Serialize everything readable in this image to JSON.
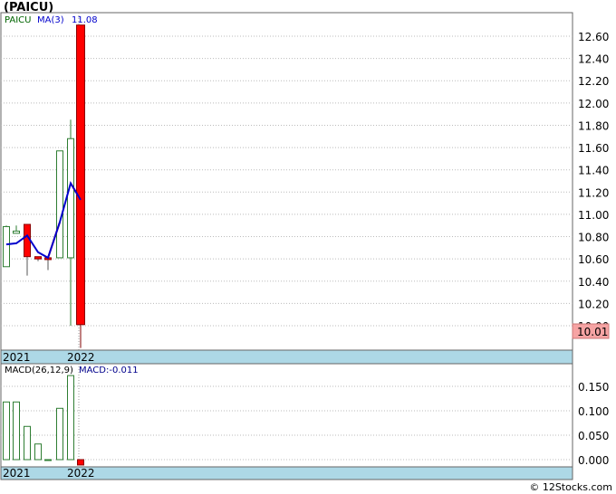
{
  "chart_data": [
    {
      "type": "candlestick",
      "title": "(PAICU)",
      "legend": {
        "symbol": "PAICU",
        "ma_label": "MA(3)",
        "last_value": "11.08"
      },
      "ylim": [
        10.0,
        12.75
      ],
      "yticks": [
        "12.60",
        "12.40",
        "12.20",
        "12.00",
        "11.80",
        "11.60",
        "11.40",
        "11.20",
        "11.00",
        "10.80",
        "10.60",
        "10.40",
        "10.20",
        "10.00"
      ],
      "x_labels": [
        "2021",
        "2022"
      ],
      "last_price_label": "10.01",
      "candles": [
        {
          "open": 10.53,
          "high": 10.9,
          "low": 10.53,
          "close": 10.89,
          "color": "green"
        },
        {
          "open": 10.83,
          "high": 10.9,
          "low": 10.83,
          "close": 10.85,
          "color": "green"
        },
        {
          "open": 10.91,
          "high": 10.91,
          "low": 10.45,
          "close": 10.62,
          "color": "red"
        },
        {
          "open": 10.62,
          "high": 10.62,
          "low": 10.58,
          "close": 10.6,
          "color": "red"
        },
        {
          "open": 10.61,
          "high": 10.63,
          "low": 10.5,
          "close": 10.6,
          "color": "red"
        },
        {
          "open": 10.61,
          "high": 11.57,
          "low": 10.61,
          "close": 11.57,
          "color": "green"
        },
        {
          "open": 10.61,
          "high": 11.85,
          "low": 10.0,
          "close": 11.68,
          "color": "green"
        },
        {
          "open": 12.7,
          "high": 12.7,
          "low": 9.8,
          "close": 10.01,
          "color": "red"
        }
      ],
      "ma_series": [
        10.73,
        10.74,
        10.81,
        10.66,
        10.61,
        10.93,
        11.28,
        11.13
      ]
    },
    {
      "type": "bar",
      "legend": {
        "label": "MACD(26,12,9)",
        "value_label": "MACD:-0.011"
      },
      "ylim": [
        -0.01,
        0.19
      ],
      "yticks": [
        "0.150",
        "0.100",
        "0.050",
        "0.000"
      ],
      "x_labels": [
        "2021",
        "2022"
      ],
      "values": [
        0.118,
        0.118,
        0.068,
        0.032,
        0.0,
        0.105,
        0.172,
        -0.011
      ]
    }
  ],
  "credit": "© 12Stocks.com",
  "colors": {
    "up": "#2e7d32",
    "down": "#ff0000",
    "ma": "#0000cc",
    "band": "#add8e6",
    "grid": "#bbbbbb",
    "macd_text": "#00008b"
  }
}
